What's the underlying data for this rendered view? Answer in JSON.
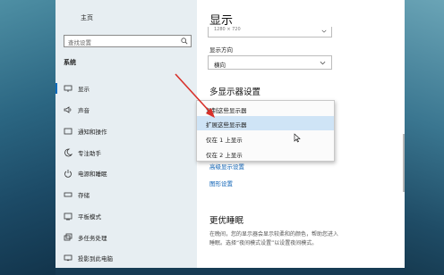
{
  "nav": {
    "home": "主页",
    "search_placeholder": "查找设置",
    "section": "系统",
    "items": [
      {
        "label": "显示",
        "icon": "monitor-icon"
      },
      {
        "label": "声音",
        "icon": "speaker-icon"
      },
      {
        "label": "通知和操作",
        "icon": "notification-icon"
      },
      {
        "label": "专注助手",
        "icon": "moon-icon"
      },
      {
        "label": "电源和睡眠",
        "icon": "power-icon"
      },
      {
        "label": "存储",
        "icon": "storage-icon"
      },
      {
        "label": "平板模式",
        "icon": "tablet-icon"
      },
      {
        "label": "多任务处理",
        "icon": "multitask-icon"
      },
      {
        "label": "投影到此电脑",
        "icon": "project-icon"
      }
    ]
  },
  "main": {
    "title": "显示",
    "resolution_value": "1280 × 720",
    "orientation_label": "显示方向",
    "orientation_value": "横向",
    "multi_display_title": "多显示器设置",
    "link_advanced": "高级显示设置",
    "link_graphics": "图形设置",
    "sleep_title": "更优睡眠",
    "sleep_text_1": "在晚间，您的显示器会显示较柔和的颜色，帮助您进入",
    "sleep_text_2": "睡眠。选择“夜间模式设置”以设置夜间模式。"
  },
  "dropdown": {
    "options": [
      "复制这些显示器",
      "扩展这些显示器",
      "仅在 1 上显示",
      "仅在 2 上显示"
    ],
    "selected_index": 1
  },
  "colors": {
    "accent": "#0f6cbd",
    "selection": "#cfe4f6",
    "annotation_arrow": "#d8302a"
  }
}
